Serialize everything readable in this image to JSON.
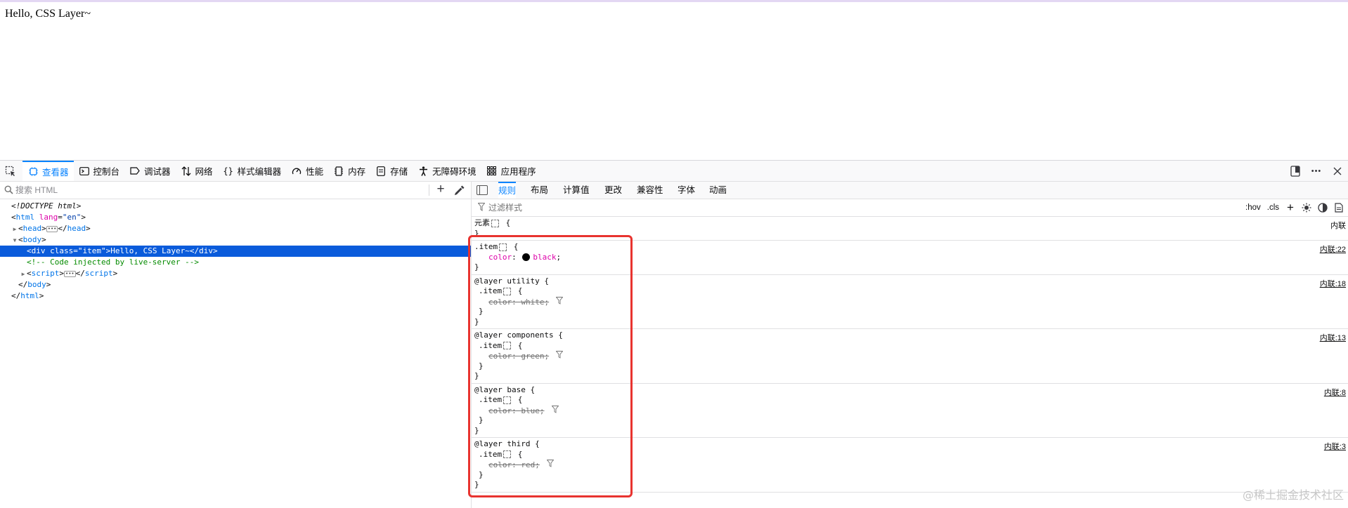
{
  "page": {
    "content_text": "Hello, CSS Layer~"
  },
  "devtools": {
    "toolbar": {
      "tabs": [
        {
          "label": "查看器",
          "icon": "inspector-icon",
          "selected": true
        },
        {
          "label": "控制台",
          "icon": "console-icon"
        },
        {
          "label": "调试器",
          "icon": "debugger-icon"
        },
        {
          "label": "网络",
          "icon": "network-icon"
        },
        {
          "label": "样式编辑器",
          "icon": "style-editor-icon"
        },
        {
          "label": "性能",
          "icon": "performance-icon"
        },
        {
          "label": "内存",
          "icon": "memory-icon"
        },
        {
          "label": "存储",
          "icon": "storage-icon"
        },
        {
          "label": "无障碍环境",
          "icon": "accessibility-icon"
        },
        {
          "label": "应用程序",
          "icon": "application-icon"
        }
      ],
      "more_label": "•••"
    },
    "html_panel": {
      "search_placeholder": "搜索 HTML",
      "add_node": "+",
      "tree": {
        "doctype": "<!DOCTYPE html>",
        "html_open_tag": "html",
        "html_attr": "lang",
        "html_attr_value": "\"en\"",
        "head_tag": "head",
        "body_tag": "body",
        "div_open": "div",
        "div_attr": "class",
        "div_attr_value": "\"item\"",
        "div_text": "Hello, CSS Layer~",
        "comment": "<!-- Code injected by live-server -->",
        "script_tag": "script"
      }
    },
    "rules_panel": {
      "tabs": [
        "规则",
        "布局",
        "计算值",
        "更改",
        "兼容性",
        "字体",
        "动画"
      ],
      "filter_placeholder": "过滤样式",
      "hov": ":hov",
      "cls": ".cls",
      "element_rule": {
        "selector": "元素",
        "brace_open": "{",
        "brace_close": "}",
        "source": "内联"
      },
      "item_rule": {
        "selector": ".item",
        "property": "color",
        "value": "black",
        "source": "内联:22"
      },
      "layers": [
        {
          "header": "@layer utility {",
          "selector": ".item",
          "property": "color",
          "value": "white",
          "source": "内联:18"
        },
        {
          "header": "@layer components {",
          "selector": ".item",
          "property": "color",
          "value": "green",
          "source": "内联:13"
        },
        {
          "header": "@layer base {",
          "selector": ".item",
          "property": "color",
          "value": "blue",
          "source": "内联:8"
        },
        {
          "header": "@layer third {",
          "selector": ".item",
          "property": "color",
          "value": "red",
          "source": "内联:3"
        }
      ]
    }
  },
  "watermark": "@稀土掘金技术社区",
  "colors": {
    "accent": "#0a84ff",
    "selection": "#0a5bdb",
    "highlight": "#e8332f"
  }
}
